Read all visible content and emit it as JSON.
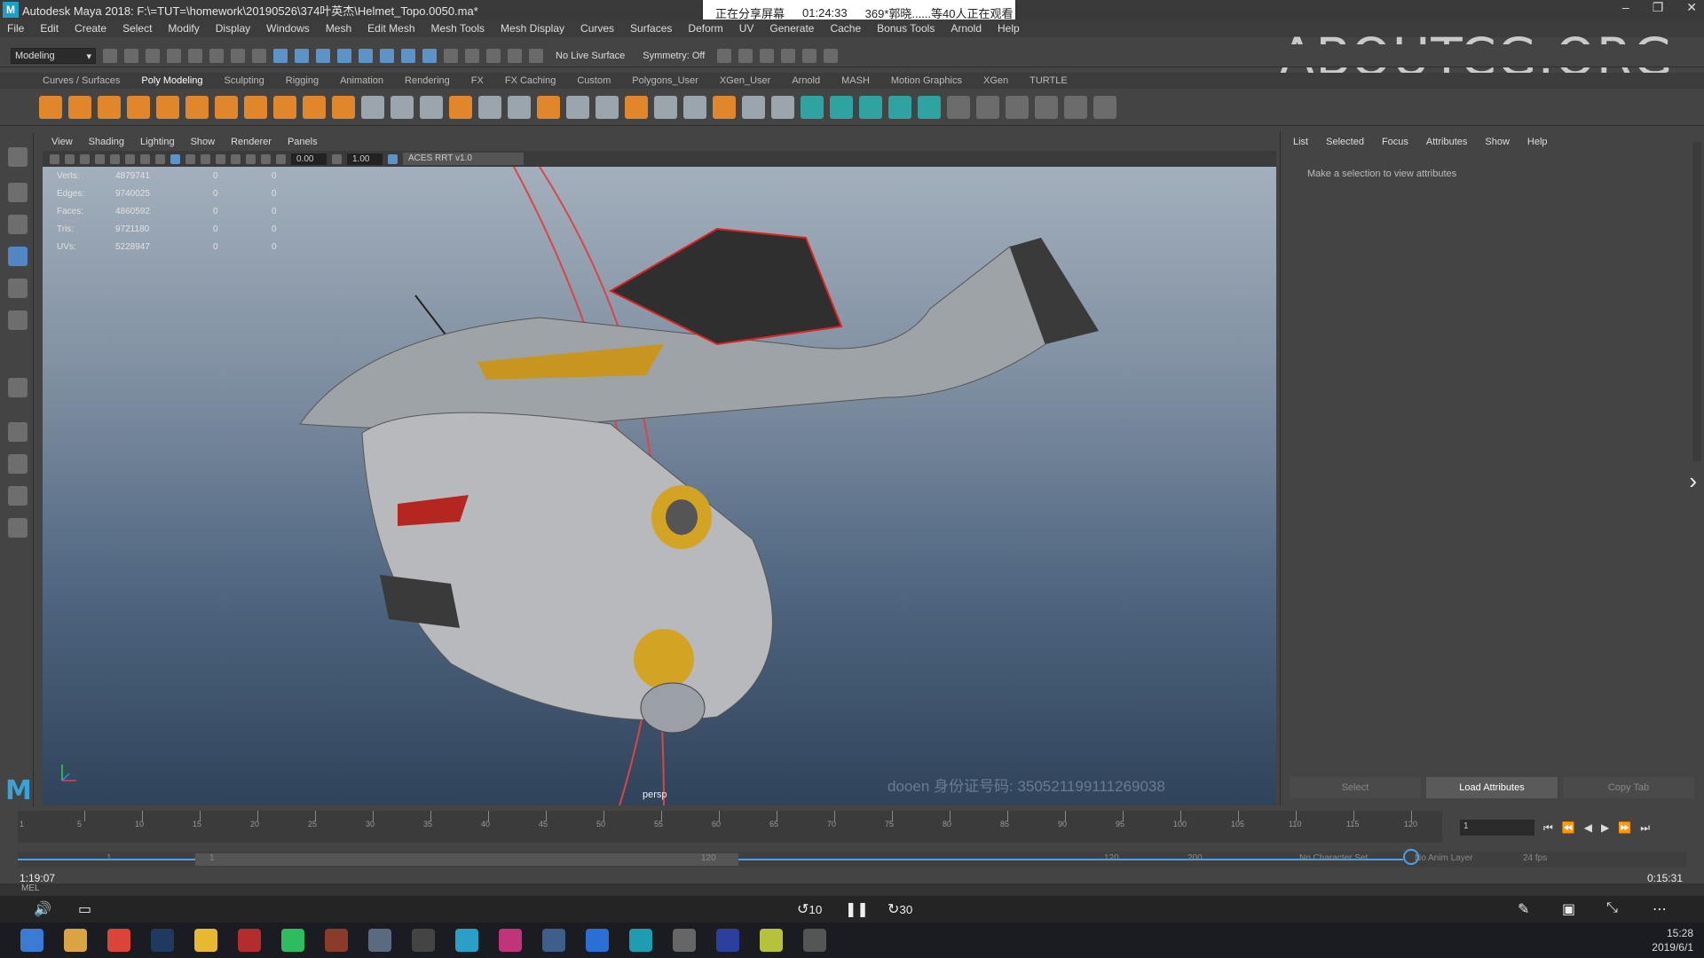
{
  "window": {
    "title": "Autodesk Maya 2018: F:\\=TUT=\\homework\\20190526\\374叶英杰\\Helmet_Topo.0050.ma*",
    "app_icon": "M",
    "min": "–",
    "max": "❐",
    "close": "✕"
  },
  "share_banner": {
    "status": "正在分享屏幕",
    "elapsed": "01:24:33",
    "viewers": "369*郭晓......等40人正在观看"
  },
  "watermark": "ABOUTCG.ORG",
  "menubar": [
    "File",
    "Edit",
    "Create",
    "Select",
    "Modify",
    "Display",
    "Windows",
    "Mesh",
    "Edit Mesh",
    "Mesh Tools",
    "Mesh Display",
    "Curves",
    "Surfaces",
    "Deform",
    "UV",
    "Generate",
    "Cache",
    "Bonus Tools",
    "Arnold",
    "Help"
  ],
  "status_line": {
    "mode": "Modeling",
    "live_surface": "No Live Surface",
    "symmetry": "Symmetry: Off"
  },
  "shelf_tabs": [
    "Curves / Surfaces",
    "Poly Modeling",
    "Sculpting",
    "Rigging",
    "Animation",
    "Rendering",
    "FX",
    "FX Caching",
    "Custom",
    "Polygons_User",
    "XGen_User",
    "Arnold",
    "MASH",
    "Motion Graphics",
    "XGen",
    "TURTLE"
  ],
  "shelf_active_tab": "Poly Modeling",
  "viewport": {
    "menu": [
      "View",
      "Shading",
      "Lighting",
      "Show",
      "Renderer",
      "Panels"
    ],
    "field_a": "0.00",
    "field_b": "1.00",
    "colorspace": "ACES RRT v1.0",
    "camera": "persp",
    "user_watermark": "dooen  身份证号码: 350521199111269038",
    "hud": [
      {
        "label": "Verts:",
        "value": "4879741",
        "sel": "0",
        "comp": "0"
      },
      {
        "label": "Edges:",
        "value": "9740025",
        "sel": "0",
        "comp": "0"
      },
      {
        "label": "Faces:",
        "value": "4860592",
        "sel": "0",
        "comp": "0"
      },
      {
        "label": "Tris:",
        "value": "9721180",
        "sel": "0",
        "comp": "0"
      },
      {
        "label": "UVs:",
        "value": "5228947",
        "sel": "0",
        "comp": "0"
      }
    ]
  },
  "attribute_editor": {
    "menu": [
      "List",
      "Selected",
      "Focus",
      "Attributes",
      "Show",
      "Help"
    ],
    "hint": "Make a selection to view attributes",
    "buttons": {
      "select": "Select",
      "load": "Load Attributes",
      "copy": "Copy Tab"
    }
  },
  "time_slider": {
    "ticks": [
      "5",
      "10",
      "15",
      "20",
      "25",
      "30",
      "35",
      "40",
      "45",
      "50",
      "55",
      "60",
      "65",
      "70",
      "75",
      "80",
      "85",
      "90",
      "95",
      "100",
      "105",
      "110",
      "115",
      "120"
    ],
    "start_label": "1",
    "current_frame": "1"
  },
  "range_slider": {
    "start": "1",
    "range_start": "1",
    "range_end": "120",
    "end": "120",
    "max": "200",
    "char_set": "No Character Set",
    "anim_layer": "No Anim Layer",
    "fps": "24 fps"
  },
  "command_line": {
    "label": "MEL"
  },
  "player": {
    "elapsed": "1:19:07",
    "remaining": "0:15:31",
    "rewind": "10",
    "forward": "30"
  },
  "taskbar": {
    "time": "15:28",
    "date": "2019/6/1"
  },
  "colors": {
    "accent_blue": "#5386c4",
    "shelf_orange": "#e2862b",
    "viewport_top": "#a3afbc",
    "viewport_bottom": "#2f435a"
  },
  "icons": [
    "search-icon",
    "gear-icon",
    "select-tool-icon",
    "move-tool-icon",
    "rotate-tool-icon",
    "scale-tool-icon",
    "maya-logo-icon",
    "volume-icon",
    "subtitles-icon",
    "pause-icon",
    "pen-icon"
  ]
}
